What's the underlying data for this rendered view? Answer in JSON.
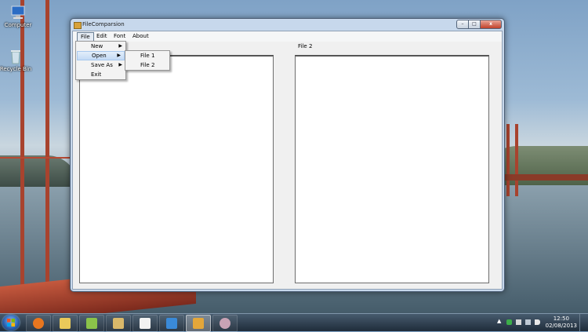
{
  "desktop": {
    "icons": [
      {
        "label": "Computer"
      },
      {
        "label": "Recycle Bin"
      }
    ]
  },
  "window": {
    "title": "FileComparsion",
    "minimize": "–",
    "maximize": "□",
    "close": "x"
  },
  "menubar": {
    "items": [
      {
        "label": "File"
      },
      {
        "label": "Edit"
      },
      {
        "label": "Font"
      },
      {
        "label": "About"
      }
    ]
  },
  "file_menu": {
    "items": [
      {
        "label": "New",
        "submenu": true
      },
      {
        "label": "Open",
        "submenu": true,
        "highlighted": true
      },
      {
        "label": "Save As",
        "submenu": true
      },
      {
        "label": "Exit",
        "submenu": false
      }
    ],
    "arrow": "▶"
  },
  "open_submenu": {
    "items": [
      {
        "label": "File 1"
      },
      {
        "label": "File 2"
      }
    ]
  },
  "panels": {
    "right_label": "File 2"
  },
  "taskbar": {
    "apps": [
      {
        "name": "firefox",
        "color": "#e8761f"
      },
      {
        "name": "file-explorer",
        "color": "#e9c95a"
      },
      {
        "name": "notepad-plus",
        "color": "#8bc34a"
      },
      {
        "name": "paint",
        "color": "#d9b86a"
      },
      {
        "name": "document",
        "color": "#f2f2f2"
      },
      {
        "name": "pen-app",
        "color": "#3a8ad8"
      },
      {
        "name": "filecomparsion-app",
        "color": "#e3a63a",
        "active": true
      },
      {
        "name": "search-app",
        "color": "#c9a3b5"
      }
    ],
    "clock_time": "12:50",
    "clock_date": "02/08/2013"
  }
}
